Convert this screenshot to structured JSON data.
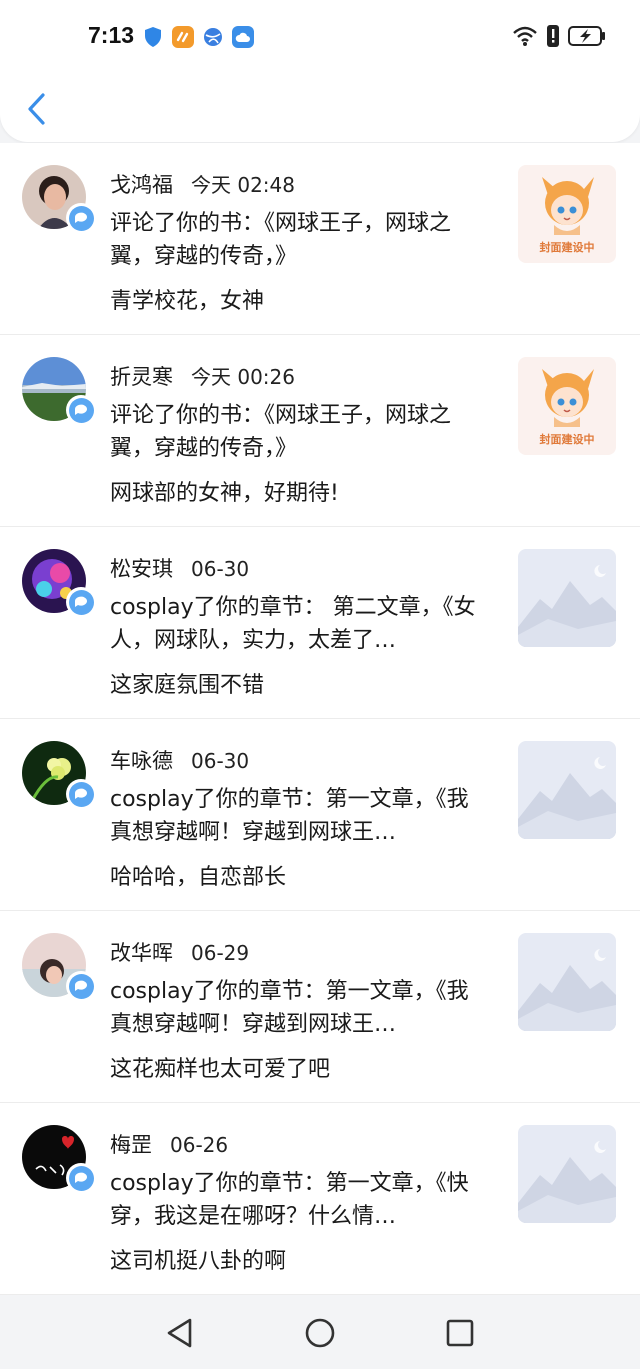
{
  "status_bar": {
    "time": "7:13",
    "left_icons": [
      "shield-icon",
      "app-icon",
      "browser-icon",
      "cloud-icon"
    ],
    "right_icons": [
      "wifi-icon",
      "alert-icon",
      "battery-charging-icon"
    ]
  },
  "header": {
    "back_icon": "chevron-left-icon"
  },
  "colors": {
    "accent": "#3a8ee8",
    "badge": "#5aa7f2",
    "cover_label": "#e07a3a"
  },
  "notifications": [
    {
      "name": "戈鸿福",
      "time": "今天 02:48",
      "action": "评论了你的书：《网球王子，网球之翼，穿越的传奇，》",
      "comment": "青学校花，女神",
      "cover": "building",
      "cover_label": "封面建设中"
    },
    {
      "name": "折灵寒",
      "time": "今天 00:26",
      "action": "评论了你的书：《网球王子，网球之翼，穿越的传奇，》",
      "comment": "网球部的女神，好期待!",
      "cover": "building",
      "cover_label": "封面建设中"
    },
    {
      "name": "松安琪",
      "time": "06-30",
      "action": "cosplay了你的章节： 第二文章，《女人，网球队，实力，太差了…",
      "comment": "这家庭氛围不错",
      "cover": "placeholder",
      "cover_label": ""
    },
    {
      "name": "车咏德",
      "time": "06-30",
      "action": "cosplay了你的章节：第一文章，《我真想穿越啊！穿越到网球王…",
      "comment": "哈哈哈，自恋部长",
      "cover": "placeholder",
      "cover_label": ""
    },
    {
      "name": "改华晖",
      "time": "06-29",
      "action": "cosplay了你的章节：第一文章，《我真想穿越啊！穿越到网球王…",
      "comment": "这花痴样也太可爱了吧",
      "cover": "placeholder",
      "cover_label": ""
    },
    {
      "name": "梅罡",
      "time": "06-26",
      "action": "cosplay了你的章节：第一文章，《快穿，我这是在哪呀？什么情…",
      "comment": "这司机挺八卦的啊",
      "cover": "placeholder",
      "cover_label": ""
    }
  ],
  "navbar": {
    "icons": [
      "back-triangle-icon",
      "home-circle-icon",
      "recents-square-icon"
    ]
  }
}
